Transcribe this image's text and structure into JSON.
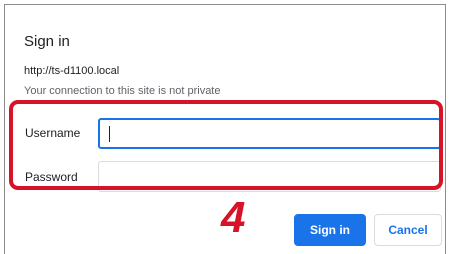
{
  "dialog": {
    "title": "Sign in",
    "url": "http://ts-d1100.local",
    "notice": "Your connection to this site is not private"
  },
  "form": {
    "username_label": "Username",
    "username_value": "",
    "password_label": "Password",
    "password_value": ""
  },
  "annotation": {
    "step_number": "4"
  },
  "buttons": {
    "sign_in": "Sign in",
    "cancel": "Cancel"
  },
  "colors": {
    "primary": "#1a73e8",
    "annotation_red": "#d7132a"
  }
}
